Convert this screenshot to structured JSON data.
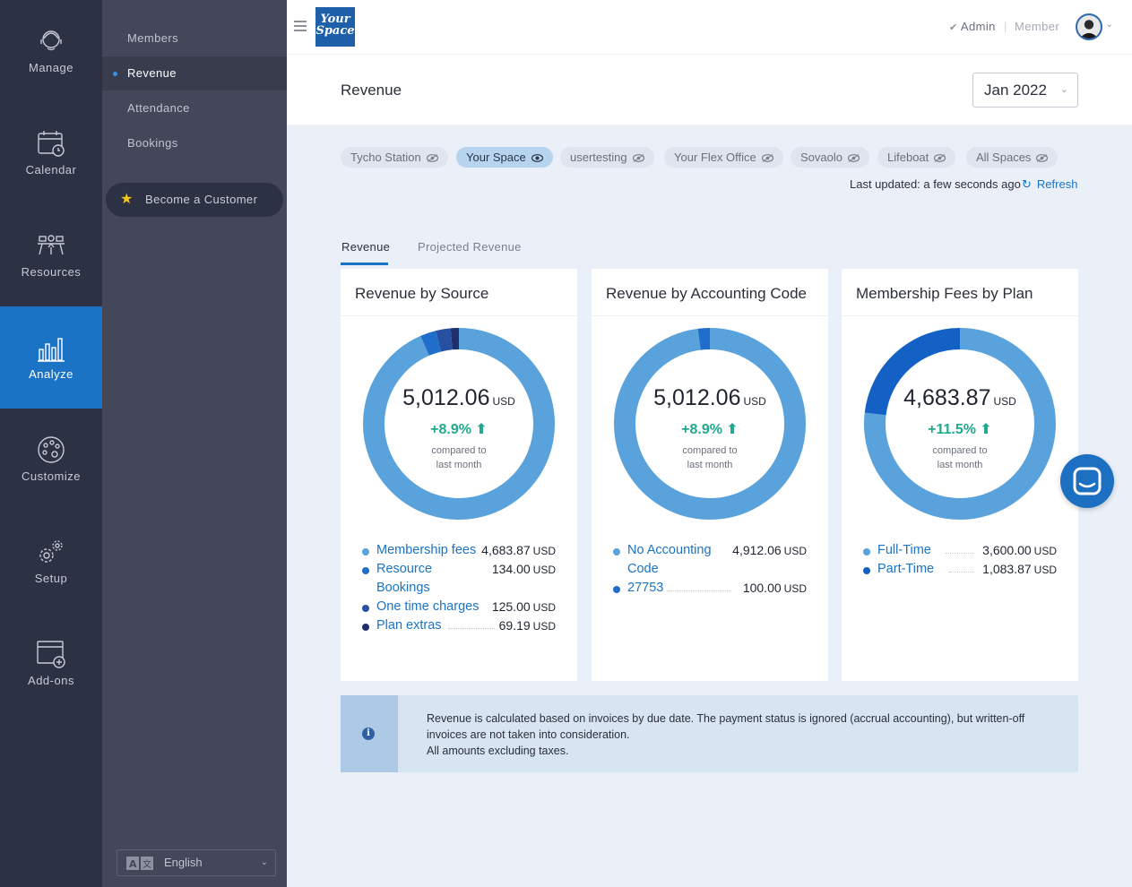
{
  "rail": [
    {
      "label": "Manage",
      "icon": "manage-icon"
    },
    {
      "label": "Calendar",
      "icon": "calendar-icon"
    },
    {
      "label": "Resources",
      "icon": "resources-icon"
    },
    {
      "label": "Analyze",
      "icon": "analyze-icon",
      "active": true
    },
    {
      "label": "Customize",
      "icon": "palette-icon"
    },
    {
      "label": "Setup",
      "icon": "gear-icon"
    },
    {
      "label": "Add-ons",
      "icon": "add-window-icon"
    }
  ],
  "subnav": {
    "items": [
      {
        "label": "Members"
      },
      {
        "label": "Revenue",
        "active": true
      },
      {
        "label": "Attendance"
      },
      {
        "label": "Bookings"
      }
    ],
    "cta_label": "Become a Customer",
    "language": "English"
  },
  "topbar": {
    "logo_line1": "Your",
    "logo_line2": "Space",
    "role_admin": "Admin",
    "role_separator": "|",
    "role_member": "Member"
  },
  "header": {
    "title": "Revenue",
    "month": "Jan 2022"
  },
  "locations": [
    {
      "label": "Tycho Station"
    },
    {
      "label": "Your Space",
      "selected": true
    },
    {
      "label": "usertesting"
    },
    {
      "label": "Your Flex Office"
    },
    {
      "label": "Sovaolo"
    },
    {
      "label": "Lifeboat"
    },
    {
      "label": "All Spaces"
    }
  ],
  "status": {
    "last_updated": "Last updated: a few seconds ago",
    "refresh_label": "Refresh"
  },
  "tabs": [
    {
      "label": "Revenue",
      "active": true
    },
    {
      "label": "Projected Revenue"
    }
  ],
  "cards": [
    {
      "title": "Revenue by Source",
      "total": "5,012.06",
      "currency": "USD",
      "delta": "+8.9% ⬆",
      "compare_line1": "compared to",
      "compare_line2": "last month",
      "legend": [
        {
          "label": "Membership fees",
          "value": "4,683.87",
          "currency": "USD",
          "color": "#5aa2dc"
        },
        {
          "label": "Resource Bookings",
          "value": "134.00",
          "currency": "USD",
          "color": "#1f6ecb"
        },
        {
          "label": "One time charges",
          "value": "125.00",
          "currency": "USD",
          "color": "#2750a3"
        },
        {
          "label": "Plan extras",
          "value": "69.19",
          "currency": "USD",
          "color": "#1e2f6b"
        }
      ]
    },
    {
      "title": "Revenue by Accounting Code",
      "total": "5,012.06",
      "currency": "USD",
      "delta": "+8.9% ⬆",
      "compare_line1": "compared to",
      "compare_line2": "last month",
      "legend": [
        {
          "label": "No Accounting Code",
          "value": "4,912.06",
          "currency": "USD",
          "color": "#5aa2dc"
        },
        {
          "label": "27753",
          "value": "100.00",
          "currency": "USD",
          "color": "#1f6ecb"
        }
      ]
    },
    {
      "title": "Membership Fees by Plan",
      "total": "4,683.87",
      "currency": "USD",
      "delta": "+11.5% ⬆",
      "compare_line1": "compared to",
      "compare_line2": "last month",
      "legend": [
        {
          "label": "Full-Time",
          "value": "3,600.00",
          "currency": "USD",
          "color": "#5aa2dc"
        },
        {
          "label": "Part-Time",
          "value": "1,083.87",
          "currency": "USD",
          "color": "#1461c6"
        }
      ]
    }
  ],
  "chart_data": [
    {
      "type": "pie",
      "title": "Revenue by Source",
      "categories": [
        "Membership fees",
        "Resource Bookings",
        "One time charges",
        "Plan extras"
      ],
      "values": [
        4683.87,
        134.0,
        125.0,
        69.19
      ],
      "colors": [
        "#5aa2dc",
        "#1f6ecb",
        "#2750a3",
        "#1e2f6b"
      ]
    },
    {
      "type": "pie",
      "title": "Revenue by Accounting Code",
      "categories": [
        "No Accounting Code",
        "27753"
      ],
      "values": [
        4912.06,
        100.0
      ],
      "colors": [
        "#5aa2dc",
        "#1f6ecb"
      ]
    },
    {
      "type": "pie",
      "title": "Membership Fees by Plan",
      "categories": [
        "Full-Time",
        "Part-Time"
      ],
      "values": [
        3600.0,
        1083.87
      ],
      "colors": [
        "#5aa2dc",
        "#1461c6"
      ]
    }
  ],
  "info": {
    "line1": "Revenue is calculated based on invoices by due date. The payment status is ignored (accrual accounting), but written-off invoices are not taken into consideration.",
    "line2": "All amounts excluding taxes."
  }
}
